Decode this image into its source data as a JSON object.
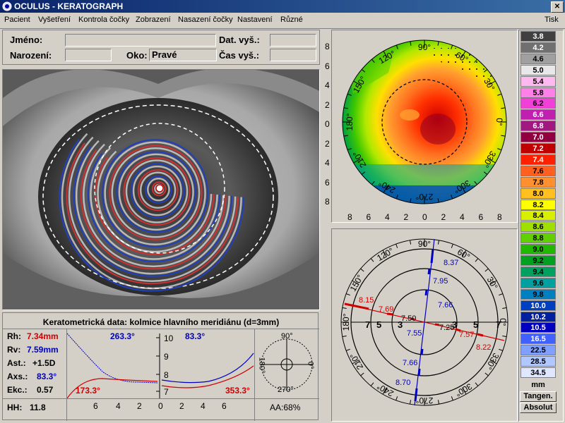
{
  "window": {
    "title": "OCULUS - KERATOGRAPH",
    "close_label": "✕"
  },
  "menu": [
    "Pacient",
    "Vyšetření",
    "Kontrola čočky",
    "Zobrazení",
    "Nasazení čočky",
    "Nastavení",
    "Různé",
    "Tisk"
  ],
  "patient": {
    "name_label": "Jméno:",
    "name_value": "",
    "birth_label": "Narození:",
    "birth_value": "",
    "eye_label": "Oko:",
    "eye_value": "Pravé",
    "exam_date_label": "Dat. vyš.:",
    "exam_date_value": "",
    "exam_time_label": "Čas vyš.:",
    "exam_time_value": ""
  },
  "topo_map": {
    "angle_labels": [
      "90°",
      "60°",
      "30°",
      "0°",
      "330°",
      "300°",
      "270°",
      "240°",
      "210°",
      "180°",
      "150°",
      "120°"
    ],
    "y_ticks": [
      "8",
      "6",
      "4",
      "2",
      "0",
      "2",
      "4",
      "6",
      "8"
    ],
    "x_ticks": [
      "8",
      "6",
      "4",
      "2",
      "0",
      "2",
      "4",
      "6",
      "8"
    ]
  },
  "meridian_map": {
    "angle_labels": [
      "90°",
      "60°",
      "30°",
      "0°",
      "330°",
      "300°",
      "270°",
      "240°",
      "210°",
      "180°",
      "150°",
      "120°"
    ],
    "axis_ticks": [
      "7",
      "5",
      "3",
      "3",
      "5",
      "7"
    ],
    "values": [
      {
        "v": "8.37",
        "c": "#0000c0"
      },
      {
        "v": "7.95",
        "c": "#0000c0"
      },
      {
        "v": "7.66",
        "c": "#0000c0"
      },
      {
        "v": "8.15",
        "c": "#d00000"
      },
      {
        "v": "7.69",
        "c": "#d00000"
      },
      {
        "v": "7.50",
        "c": "#000000"
      },
      {
        "v": "7.25",
        "c": "#000000"
      },
      {
        "v": "7.57",
        "c": "#d00000"
      },
      {
        "v": "7.55",
        "c": "#0000c0"
      },
      {
        "v": "8.22",
        "c": "#d00000"
      },
      {
        "v": "7.66",
        "c": "#0000c0"
      },
      {
        "v": "8.70",
        "c": "#0000c0"
      }
    ]
  },
  "scale": {
    "items": [
      {
        "v": "3.8",
        "c": "#404040",
        "t": "#ffffff"
      },
      {
        "v": "4.2",
        "c": "#707070",
        "t": "#ffffff"
      },
      {
        "v": "4.6",
        "c": "#a0a0a0",
        "t": "#000000"
      },
      {
        "v": "5.0",
        "c": "#e8e8e8",
        "t": "#000000"
      },
      {
        "v": "5.4",
        "c": "#ffb8f0",
        "t": "#000000"
      },
      {
        "v": "5.8",
        "c": "#ff80e8",
        "t": "#000000"
      },
      {
        "v": "6.2",
        "c": "#f040d8",
        "t": "#000000"
      },
      {
        "v": "6.6",
        "c": "#c020b0",
        "t": "#ffffff"
      },
      {
        "v": "6.8",
        "c": "#a01880",
        "t": "#ffffff"
      },
      {
        "v": "7.0",
        "c": "#900040",
        "t": "#ffffff"
      },
      {
        "v": "7.2",
        "c": "#c00000",
        "t": "#ffffff"
      },
      {
        "v": "7.4",
        "c": "#ff2000",
        "t": "#ffffff"
      },
      {
        "v": "7.6",
        "c": "#ff6020",
        "t": "#000000"
      },
      {
        "v": "7.8",
        "c": "#ff9030",
        "t": "#000000"
      },
      {
        "v": "8.0",
        "c": "#ffc020",
        "t": "#000000"
      },
      {
        "v": "8.2",
        "c": "#ffff00",
        "t": "#000000"
      },
      {
        "v": "8.4",
        "c": "#d8f000",
        "t": "#000000"
      },
      {
        "v": "8.6",
        "c": "#a0e000",
        "t": "#000000"
      },
      {
        "v": "8.8",
        "c": "#60d000",
        "t": "#000000"
      },
      {
        "v": "9.0",
        "c": "#20b800",
        "t": "#000000"
      },
      {
        "v": "9.2",
        "c": "#00a020",
        "t": "#000000"
      },
      {
        "v": "9.4",
        "c": "#00a060",
        "t": "#000000"
      },
      {
        "v": "9.6",
        "c": "#00a0a0",
        "t": "#000000"
      },
      {
        "v": "9.8",
        "c": "#0080c0",
        "t": "#000000"
      },
      {
        "v": "10.0",
        "c": "#0040c0",
        "t": "#ffffff"
      },
      {
        "v": "10.2",
        "c": "#0020a0",
        "t": "#ffffff"
      },
      {
        "v": "10.5",
        "c": "#0000c0",
        "t": "#ffffff"
      },
      {
        "v": "16.5",
        "c": "#4060ff",
        "t": "#ffffff"
      },
      {
        "v": "22.5",
        "c": "#80a0ff",
        "t": "#000000"
      },
      {
        "v": "28.5",
        "c": "#b0c8ff",
        "t": "#000000"
      },
      {
        "v": "34.5",
        "c": "#e0e8ff",
        "t": "#000000"
      }
    ],
    "unit": "mm",
    "btn_tangential": "Tangen.",
    "btn_absolute": "Absolut"
  },
  "kerato": {
    "title": "Keratometrická data: kolmice hlavního meridiánu (d=3mm)",
    "rh_label": "Rh:",
    "rh_value": "7.34mm",
    "rv_label": "Rv:",
    "rv_value": "7.59mm",
    "ast_label": "Ast.:",
    "ast_value": "+1.5D",
    "axs_label": "Axs.:",
    "axs_value": "83.3°",
    "ekc_label": "Ekc.:",
    "ekc_value": "0.57",
    "hh_label": "HH:",
    "hh_value": "11.8",
    "graph1_blue_angle": "263.3°",
    "graph1_red_angle": "173.3°",
    "graph2_blue_angle": "83.3°",
    "graph2_red_angle": "353.3°",
    "y_ticks": [
      "10",
      "9",
      "8",
      "7"
    ],
    "x_ticks_left": [
      "6",
      "4",
      "2"
    ],
    "x_ticks_right": [
      "0",
      "2",
      "4",
      "6"
    ],
    "small_dial": {
      "top": "90°",
      "bottom": "270°",
      "left": "180°",
      "right": "0°"
    },
    "aa_label": "AA:68%"
  }
}
